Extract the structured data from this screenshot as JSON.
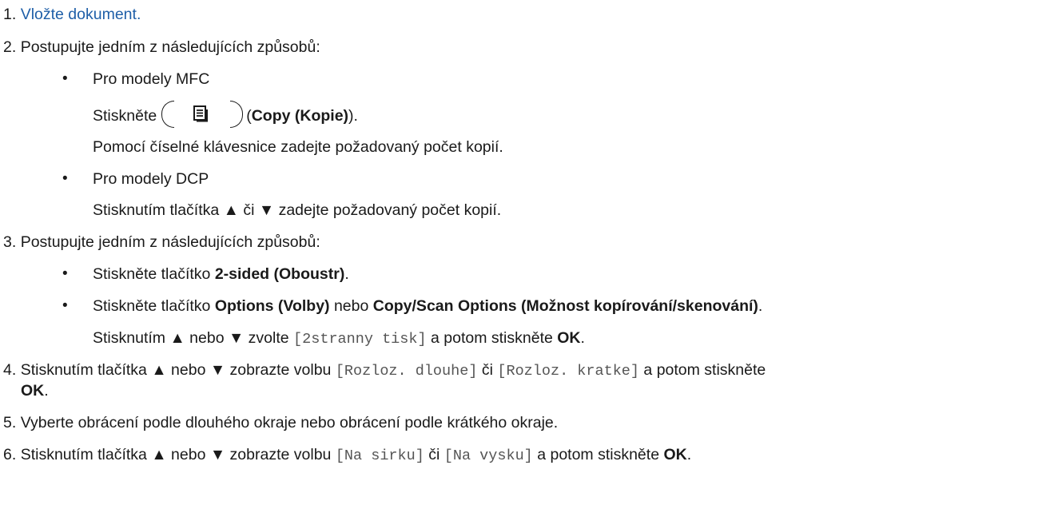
{
  "steps": {
    "s1": {
      "num": "1.",
      "link": "Vložte dokument."
    },
    "s2": {
      "num": "2.",
      "text": "Postupujte jedním z následujících způsobů:",
      "bullet_mfc": "Pro modely MFC",
      "press_prefix": "Stiskněte",
      "copy_open": "(",
      "copy_label": "Copy (Kopie)",
      "copy_close": ").",
      "mfc_text": "Pomocí číselné klávesnice zadejte požadovaný počet kopií.",
      "bullet_dcp": "Pro modely DCP",
      "dcp_text": "Stisknutím tlačítka ▲ či ▼ zadejte požadovaný počet kopií."
    },
    "s3": {
      "num": "3.",
      "text": "Postupujte jedním z následujících způsobů:",
      "b1_prefix": "Stiskněte tlačítko ",
      "b1_bold": "2-sided (Oboustr)",
      "b1_suffix": ".",
      "b2_prefix": "Stiskněte tlačítko ",
      "b2_bold1": "Options (Volby)",
      "b2_mid": " nebo ",
      "b2_bold2": "Copy/Scan Options (Možnost kopírování/skenování)",
      "b2_suffix": ".",
      "b2_sub_prefix": "Stisknutím ▲ nebo ▼ zvolte ",
      "b2_sub_code": "[2stranny tisk]",
      "b2_sub_mid": " a potom stiskněte ",
      "b2_sub_bold": "OK",
      "b2_sub_suffix": "."
    },
    "s4": {
      "num": "4.",
      "prefix": "Stisknutím tlačítka ▲ nebo ▼ zobrazte volbu ",
      "code1": "[Rozloz. dlouhe]",
      "mid1": " či ",
      "code2": "[Rozloz. kratke]",
      "mid2": " a potom stiskněte",
      "bold": "OK",
      "suffix": "."
    },
    "s5": {
      "num": "5.",
      "text": "Vyberte obrácení podle dlouhého okraje nebo obrácení podle krátkého okraje."
    },
    "s6": {
      "num": "6.",
      "prefix": "Stisknutím tlačítka ▲ nebo ▼ zobrazte volbu ",
      "code1": "[Na sirku]",
      "mid1": " či ",
      "code2": "[Na vysku]",
      "mid2": " a potom stiskněte ",
      "bold": "OK",
      "suffix": "."
    }
  },
  "icons": {
    "copy_key": "copy-document-icon"
  },
  "colors": {
    "link": "#1f5fa8",
    "text": "#1a1a1a",
    "code": "#555555"
  }
}
